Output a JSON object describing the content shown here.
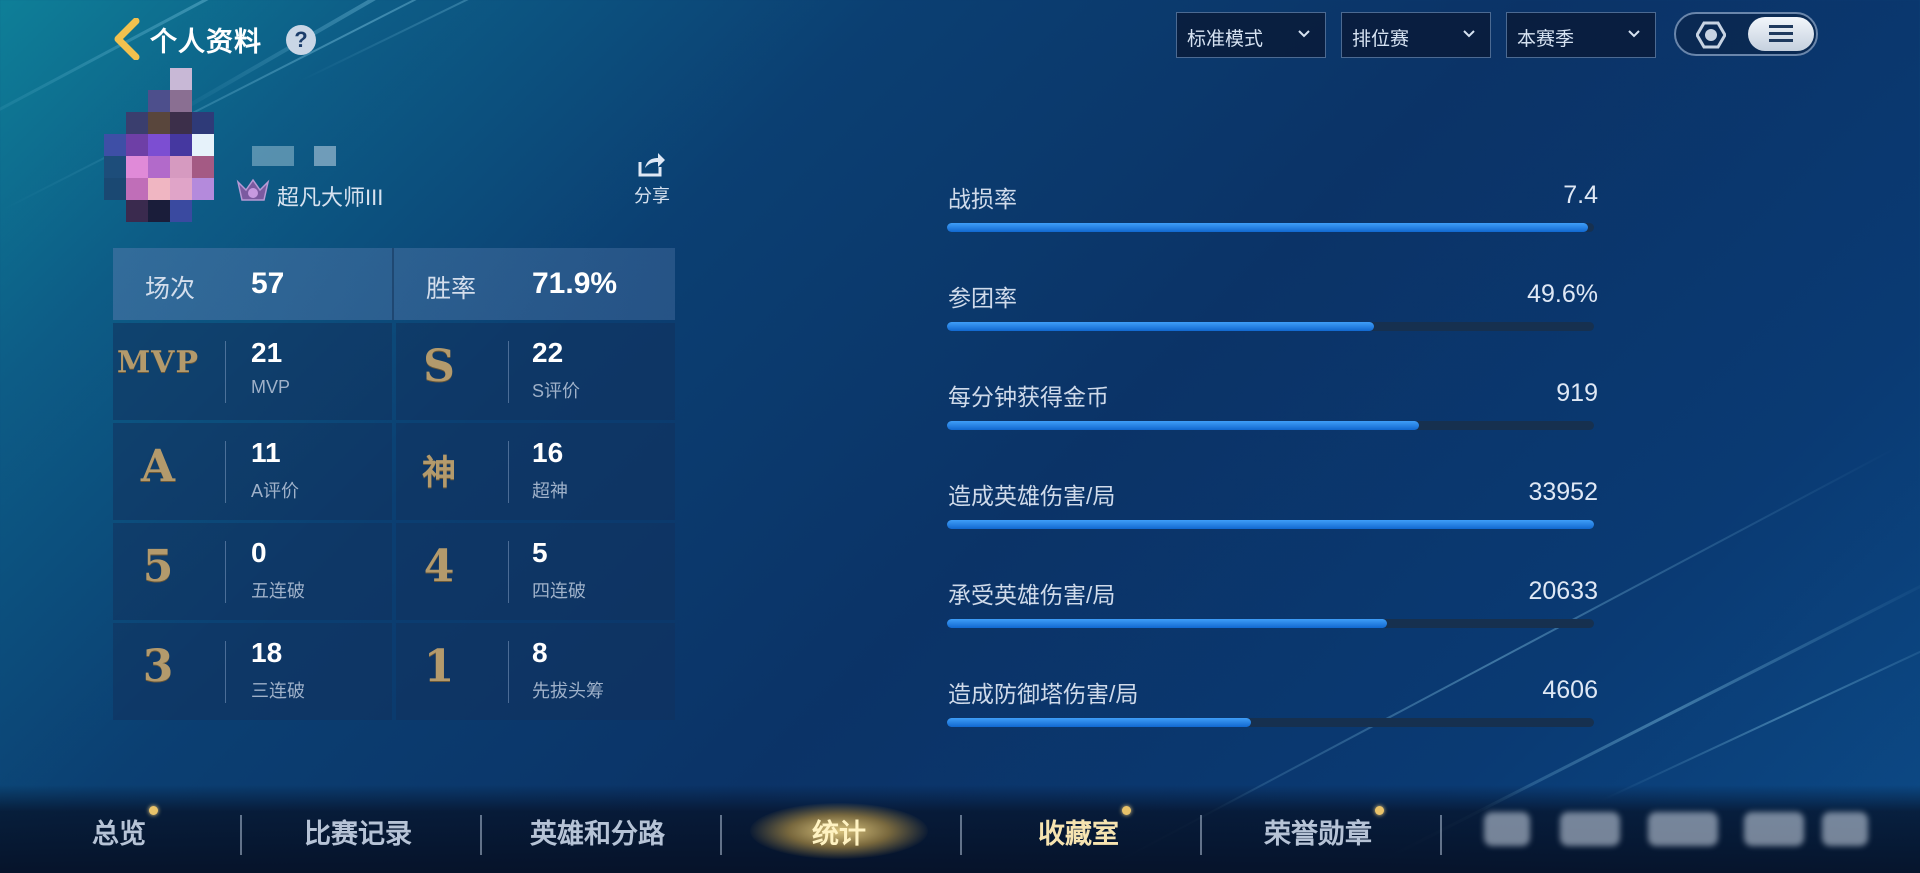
{
  "header": {
    "title": "个人资料",
    "help_label": "?",
    "filters": [
      {
        "label": "标准模式"
      },
      {
        "label": "排位赛"
      },
      {
        "label": "本赛季"
      }
    ]
  },
  "profile": {
    "rank": "超凡大师III",
    "share_label": "分享"
  },
  "summary": {
    "matches_label": "场次",
    "matches_value": "57",
    "winrate_label": "胜率",
    "winrate_value": "71.9%"
  },
  "stats": [
    {
      "badge": "MVP",
      "value": "21",
      "label": "MVP"
    },
    {
      "badge": "S",
      "value": "22",
      "label": "S评价"
    },
    {
      "badge": "A",
      "value": "11",
      "label": "A评价"
    },
    {
      "badge": "神",
      "value": "16",
      "label": "超神"
    },
    {
      "badge": "5",
      "value": "0",
      "label": "五连破"
    },
    {
      "badge": "4",
      "value": "5",
      "label": "四连破"
    },
    {
      "badge": "3",
      "value": "18",
      "label": "三连破"
    },
    {
      "badge": "1",
      "value": "8",
      "label": "先拔头筹"
    }
  ],
  "metrics": [
    {
      "label": "战损率",
      "value": "7.4",
      "fill": 0.99
    },
    {
      "label": "参团率",
      "value": "49.6%",
      "fill": 0.66
    },
    {
      "label": "每分钟获得金币",
      "value": "919",
      "fill": 0.73
    },
    {
      "label": "造成英雄伤害/局",
      "value": "33952",
      "fill": 1.0
    },
    {
      "label": "承受英雄伤害/局",
      "value": "20633",
      "fill": 0.68
    },
    {
      "label": "造成防御塔伤害/局",
      "value": "4606",
      "fill": 0.47
    }
  ],
  "nav": {
    "tabs": [
      {
        "label": "总览",
        "dot": true
      },
      {
        "label": "比赛记录",
        "dot": false
      },
      {
        "label": "英雄和分路",
        "dot": false
      },
      {
        "label": "统计",
        "dot": false,
        "active": true
      },
      {
        "label": "收藏室",
        "dot": true
      },
      {
        "label": "荣誉勋章",
        "dot": true
      }
    ]
  },
  "colors": {
    "bar_fill": "#2b86ee",
    "bar_track": "#16304f",
    "badge_gold": "#b39a6c",
    "active_glow": "#f0cd78"
  }
}
